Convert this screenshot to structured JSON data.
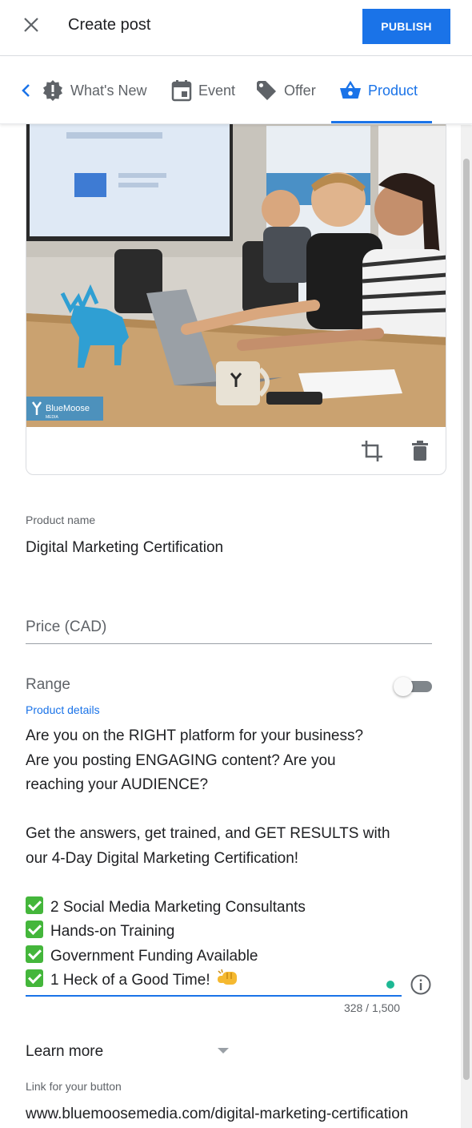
{
  "header": {
    "title": "Create post",
    "publish_label": "PUBLISH"
  },
  "tabs": [
    {
      "label": "What's New",
      "icon": "megaphone-badge-icon",
      "active": false
    },
    {
      "label": "Event",
      "icon": "calendar-icon",
      "active": false
    },
    {
      "label": "Offer",
      "icon": "tag-icon",
      "active": false
    },
    {
      "label": "Product",
      "icon": "shopping-basket-icon",
      "active": true
    }
  ],
  "image": {
    "logo_text": "BlueMoose",
    "logo_sub": "MEDIA",
    "actions": [
      "crop-icon",
      "trash-icon"
    ]
  },
  "product_name": {
    "label": "Product name",
    "value": "Digital Marketing Certification"
  },
  "price": {
    "placeholder": "Price (CAD)"
  },
  "range": {
    "label": "Range",
    "enabled": false
  },
  "details": {
    "label": "Product details",
    "lines": [
      "Are you on the RIGHT platform for your business?",
      "Are you posting ENGAGING content? Are you",
      "reaching your AUDIENCE?",
      "",
      "Get the answers, get trained, and GET RESULTS with",
      "our 4-Day Digital Marketing Certification!",
      "",
      "2 Social Media Marketing Consultants",
      "Hands-on Training",
      "Government Funding Available",
      "1 Heck of a Good Time!"
    ],
    "char_count": "328 / 1,500"
  },
  "button_type": {
    "value": "Learn more"
  },
  "link": {
    "label": "Link for your button",
    "value": "www.bluemoosemedia.com/digital-marketing-certification"
  },
  "colors": {
    "accent": "#1a73e8",
    "check_green": "#44b63b"
  }
}
